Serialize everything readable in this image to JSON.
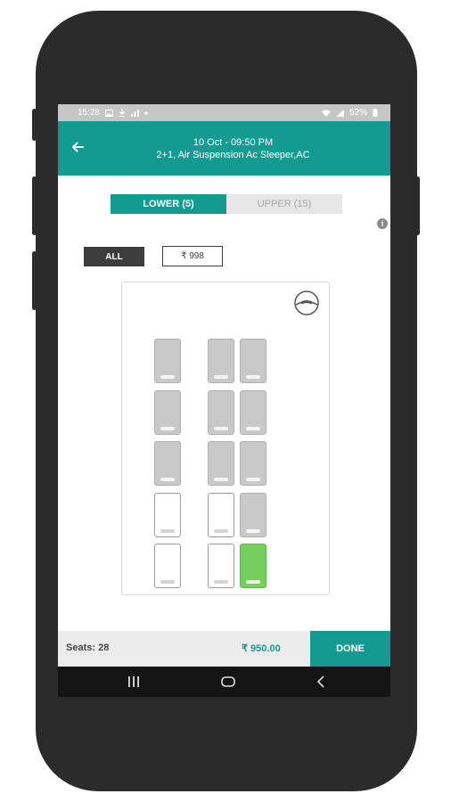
{
  "status_bar": {
    "time": "15:28",
    "left_icons": [
      "image-icon",
      "download-icon",
      "signal-bars-icon",
      "dot-icon"
    ],
    "right_icons": [
      "wifi-icon",
      "signal-icon"
    ],
    "battery": "52%"
  },
  "app_bar": {
    "datetime": "10 Oct - 09:50 PM",
    "bus_type": "2+1, Air Suspension Ac Sleeper,AC",
    "back_icon": "back-arrow-icon"
  },
  "deck_tabs": [
    {
      "label": "LOWER (5)",
      "active": true
    },
    {
      "label": "UPPER (15)",
      "active": false
    }
  ],
  "info_icon": "info-icon",
  "filters": {
    "all_label": "ALL",
    "price_label": "₹ 998"
  },
  "seat_map": {
    "steering_icon": "steering-wheel-icon",
    "legend_states": [
      "booked",
      "available",
      "selected"
    ],
    "seats": [
      {
        "row": 0,
        "col": 0,
        "state": "booked"
      },
      {
        "row": 0,
        "col": 2,
        "state": "booked"
      },
      {
        "row": 0,
        "col": 3,
        "state": "booked"
      },
      {
        "row": 1,
        "col": 0,
        "state": "booked"
      },
      {
        "row": 1,
        "col": 2,
        "state": "booked"
      },
      {
        "row": 1,
        "col": 3,
        "state": "booked"
      },
      {
        "row": 2,
        "col": 0,
        "state": "booked"
      },
      {
        "row": 2,
        "col": 2,
        "state": "booked"
      },
      {
        "row": 2,
        "col": 3,
        "state": "booked"
      },
      {
        "row": 3,
        "col": 0,
        "state": "available"
      },
      {
        "row": 3,
        "col": 2,
        "state": "available"
      },
      {
        "row": 3,
        "col": 3,
        "state": "booked"
      },
      {
        "row": 4,
        "col": 0,
        "state": "available"
      },
      {
        "row": 4,
        "col": 2,
        "state": "available"
      },
      {
        "row": 4,
        "col": 3,
        "state": "selected"
      }
    ]
  },
  "bottom_bar": {
    "seats_label": "Seats: 28",
    "total": "₹  950.00",
    "done_label": "DONE"
  },
  "nav_bar": {
    "icons": [
      "recent-apps-icon",
      "home-icon",
      "back-icon"
    ]
  },
  "colors": {
    "accent": "#139a91",
    "selected_seat": "#74cf5c",
    "booked_seat": "#c9c9c9"
  }
}
